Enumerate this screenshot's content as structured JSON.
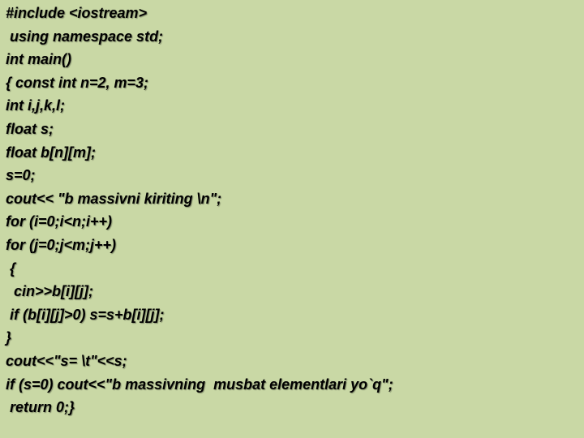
{
  "slide": {
    "background": "#c9d8a5",
    "text_color": "#000000",
    "code_lines": [
      "#include <iostream>",
      " using namespace std;",
      "int main()",
      "{ const int n=2, m=3;",
      "int i,j,k,l;",
      "float s;",
      "float b[n][m];",
      "s=0;",
      "cout<< \"b massivni kiriting \\n\";",
      "for (i=0;i<n;i++)",
      "for (j=0;j<m;j++)",
      " {",
      "  cin>>b[i][j];",
      " if (b[i][j]>0) s=s+b[i][j];",
      "}",
      "cout<<\"s= \\t\"<<s;",
      "if (s=0) cout<<\"b massivning  musbat elementlari yo`q\";",
      " return 0;}"
    ]
  }
}
